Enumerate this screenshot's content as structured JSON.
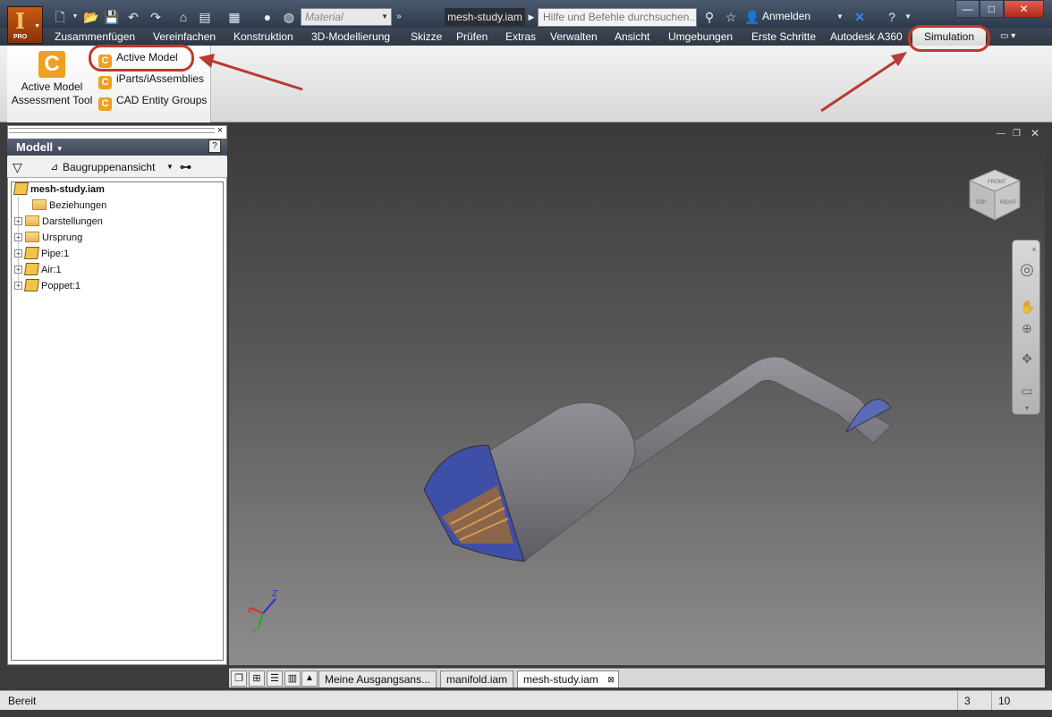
{
  "app": {
    "title": "mesh-study.iam",
    "logo_letter": "I",
    "edition": "PRO",
    "material_placeholder": "Material",
    "search_placeholder": "Hilfe und Befehle durchsuchen..",
    "sign_in": "Anmelden"
  },
  "menu": {
    "tabs": [
      "Zusammenfügen",
      "Vereinfachen",
      "Konstruktion",
      "3D-Modellierung",
      "Skizze",
      "Prüfen",
      "Extras",
      "Verwalten",
      "Ansicht",
      "Umgebungen",
      "Erste Schritte",
      "Autodesk A360"
    ],
    "active": "Simulation"
  },
  "ribbon": {
    "big_tool": [
      "Active Model",
      "Assessment Tool"
    ],
    "commands": [
      "Active Model",
      "iParts/iAssemblies",
      "CAD Entity Groups"
    ]
  },
  "browser": {
    "title": "Modell",
    "view": "Baugruppenansicht",
    "root": "mesh-study.iam",
    "items": [
      {
        "label": "Beziehungen",
        "kind": "folder",
        "expand": false
      },
      {
        "label": "Darstellungen",
        "kind": "folder",
        "expand": true
      },
      {
        "label": "Ursprung",
        "kind": "folder",
        "expand": true
      },
      {
        "label": "Pipe:1",
        "kind": "part",
        "expand": true
      },
      {
        "label": "Air:1",
        "kind": "part",
        "expand": true
      },
      {
        "label": "Poppet:1",
        "kind": "part",
        "expand": true
      }
    ]
  },
  "viewcube": {
    "face_top": "FRONT",
    "face_left": "TOP",
    "face_right": "RIGHT"
  },
  "doc_tabs": [
    "Meine Ausgangsans...",
    "manifold.iam",
    "mesh-study.iam"
  ],
  "status": {
    "text": "Bereit",
    "count1": "3",
    "count2": "10"
  },
  "colors": {
    "annotation": "#c0392b",
    "ribbon_icon": "#f0a020"
  }
}
